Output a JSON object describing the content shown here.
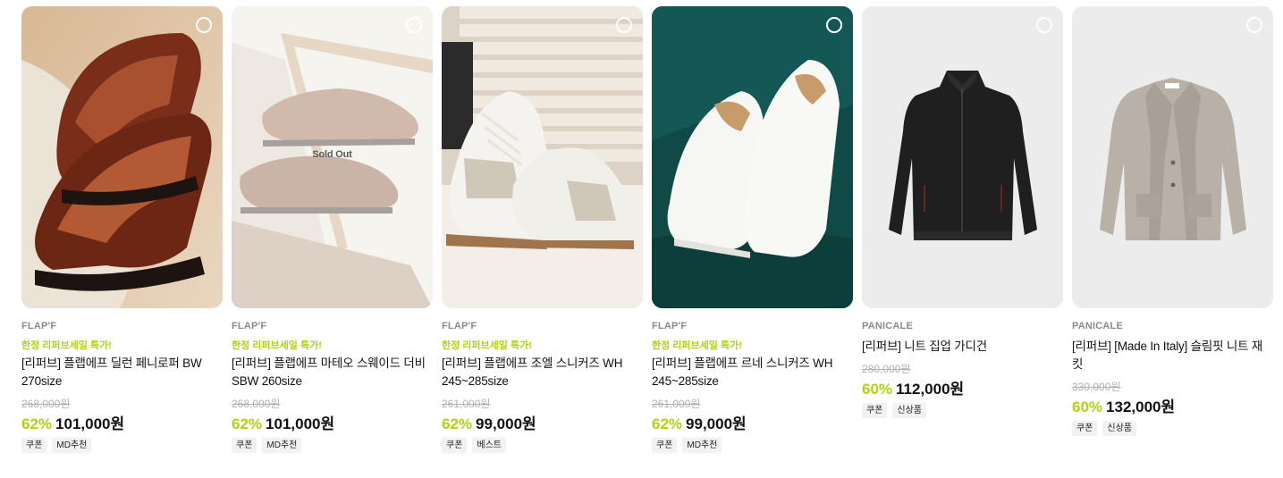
{
  "products": [
    {
      "brand": "FLAP'F",
      "promo": "한정 리퍼브세일 특가!",
      "name": "[리퍼브] 플랩에프 딜런 페니로퍼 BW 270size",
      "original_price": "268,000원",
      "discount": "62%",
      "price": "101,000원",
      "tags": [
        "쿠폰",
        "MD추천"
      ],
      "sold_out": false,
      "image": "brown-penny-loafers"
    },
    {
      "brand": "FLAP'F",
      "promo": "한정 리퍼브세일 특가!",
      "name": "[리퍼브] 플랩에프 마테오 스웨이드 더비 SBW 260size",
      "original_price": "268,000원",
      "discount": "62%",
      "price": "101,000원",
      "tags": [
        "쿠폰",
        "MD추천"
      ],
      "sold_out": true,
      "sold_out_label": "Sold Out",
      "image": "suede-derby-shoes"
    },
    {
      "brand": "FLAP'F",
      "promo": "한정 리퍼브세일 특가!",
      "name": "[리퍼브] 플랩에프 조엘 스니커즈 WH 245~285size",
      "original_price": "261,000원",
      "discount": "62%",
      "price": "99,000원",
      "tags": [
        "쿠폰",
        "베스트"
      ],
      "sold_out": false,
      "image": "white-gat-sneakers"
    },
    {
      "brand": "FLAP'F",
      "promo": "한정 리퍼브세일 특가!",
      "name": "[리퍼브] 플랩에프 르네 스니커즈 WH 245~285size",
      "original_price": "261,000원",
      "discount": "62%",
      "price": "99,000원",
      "tags": [
        "쿠폰",
        "MD추천"
      ],
      "sold_out": false,
      "image": "white-sneakers-green"
    },
    {
      "brand": "PANICALE",
      "promo": "",
      "name": "[리퍼브] 니트 집업 가디건",
      "original_price": "280,000원",
      "discount": "60%",
      "price": "112,000원",
      "tags": [
        "쿠폰",
        "신상품"
      ],
      "sold_out": false,
      "image": "black-zip-cardigan"
    },
    {
      "brand": "PANICALE",
      "promo": "",
      "name": "[리퍼브] [Made In Italy] 슬림핏 니트 재킷",
      "original_price": "330,000원",
      "discount": "60%",
      "price": "132,000원",
      "tags": [
        "쿠폰",
        "신상품"
      ],
      "sold_out": false,
      "image": "grey-knit-jacket"
    }
  ],
  "colors": {
    "accent": "#a9d60f",
    "strike": "#b0b0b0",
    "brand_text": "#8a8a8a"
  }
}
